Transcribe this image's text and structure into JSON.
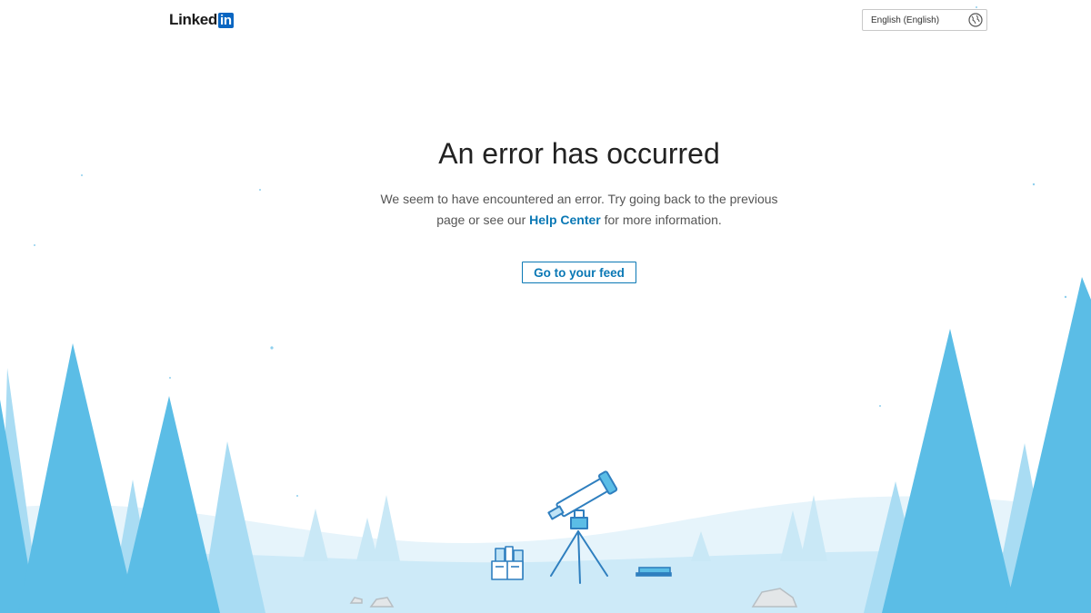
{
  "header": {
    "logo_text": "Linked",
    "logo_badge": "in",
    "language": "English (English)",
    "language_icon": "globe-icon"
  },
  "main": {
    "title": "An error has occurred",
    "desc_before": "We seem to have encountered an error. Try going back to the previous page or see our",
    "help_link": "Help Center",
    "desc_after": "for more information.",
    "button_label": "Go to your feed"
  },
  "colors": {
    "brand": "#0a66c2",
    "link": "#0a78b5",
    "tree_dark": "#5bbde6",
    "tree_light": "#a9dcf3",
    "hill": "#dff1fb"
  },
  "illustration": {
    "icons": [
      "telescope-icon",
      "books-icon",
      "book-icon",
      "rock-icon",
      "tree-icon"
    ]
  }
}
